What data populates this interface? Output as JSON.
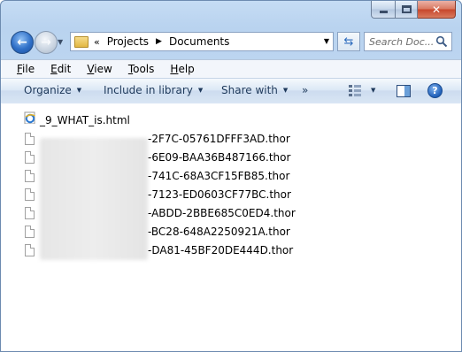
{
  "nav": {
    "breadcrumb": [
      "Projects",
      "Documents"
    ],
    "search_placeholder": "Search Doc..."
  },
  "menu": [
    {
      "label": "File",
      "accel": "F",
      "rest": "ile"
    },
    {
      "label": "Edit",
      "accel": "E",
      "rest": "dit"
    },
    {
      "label": "View",
      "accel": "V",
      "rest": "iew"
    },
    {
      "label": "Tools",
      "accel": "T",
      "rest": "ools"
    },
    {
      "label": "Help",
      "accel": "H",
      "rest": "elp"
    }
  ],
  "commands": {
    "organize": "Organize",
    "include": "Include in library",
    "share": "Share with",
    "more": "»"
  },
  "files": [
    {
      "name": "_9_WHAT_is.html",
      "icon": "html-file-icon"
    },
    {
      "name": "-2F7C-05761DFFF3AD.thor",
      "icon": "document-icon"
    },
    {
      "name": "-6E09-BAA36B487166.thor",
      "icon": "document-icon"
    },
    {
      "name": "-741C-68A3CF15FB85.thor",
      "icon": "document-icon"
    },
    {
      "name": "-7123-ED0603CF77BC.thor",
      "icon": "document-icon"
    },
    {
      "name": "-ABDD-2BBE685C0ED4.thor",
      "icon": "document-icon"
    },
    {
      "name": "-BC28-648A2250921A.thor",
      "icon": "document-icon"
    },
    {
      "name": "-DA81-45BF20DE444D.thor",
      "icon": "document-icon"
    }
  ]
}
